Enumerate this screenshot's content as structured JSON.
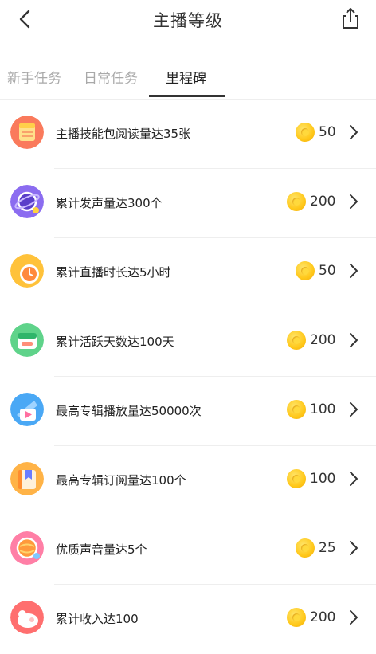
{
  "header": {
    "title": "主播等级"
  },
  "tabs": [
    {
      "label": "新手任务"
    },
    {
      "label": "日常任务"
    },
    {
      "label": "里程碑"
    }
  ],
  "tasks": [
    {
      "label": "主播技能包阅读量达35张",
      "reward": "50",
      "icon": "skill-book-icon"
    },
    {
      "label": "累计发声量达300个",
      "reward": "200",
      "icon": "planet-voice-icon"
    },
    {
      "label": "累计直播时长达5小时",
      "reward": "50",
      "icon": "clock-icon"
    },
    {
      "label": "累计活跃天数达100天",
      "reward": "200",
      "icon": "calendar-icon"
    },
    {
      "label": "最高专辑播放量达50000次",
      "reward": "100",
      "icon": "play-icon"
    },
    {
      "label": "最高专辑订阅量达100个",
      "reward": "100",
      "icon": "bookmark-icon"
    },
    {
      "label": "优质声音量达5个",
      "reward": "25",
      "icon": "quality-voice-icon"
    },
    {
      "label": "累计收入达100",
      "reward": "200",
      "icon": "income-icon"
    }
  ],
  "colors": {
    "coin": "#ffc81a",
    "active_tab": "#222222",
    "inactive_tab": "#a9a9a9"
  }
}
